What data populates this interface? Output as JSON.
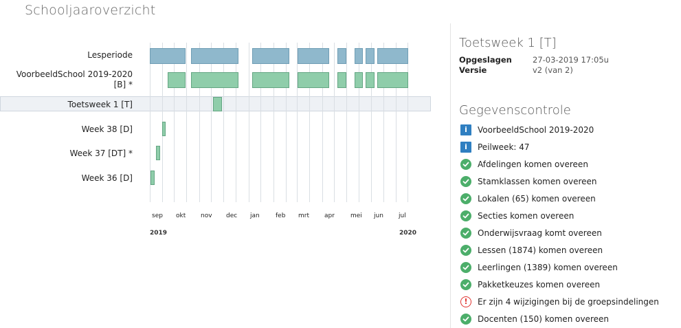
{
  "page_title": "Schooljaaroverzicht",
  "timeline": {
    "rows": [
      {
        "label": "Lesperiode",
        "segments": [
          [
            "2019-09-01",
            "2019-10-15"
          ],
          [
            "2019-10-22",
            "2019-12-20"
          ],
          [
            "2020-01-06",
            "2020-02-21"
          ],
          [
            "2020-03-02",
            "2020-04-10"
          ],
          [
            "2020-04-20",
            "2020-05-01"
          ],
          [
            "2020-05-11",
            "2020-05-22"
          ],
          [
            "2020-05-25",
            "2020-06-05"
          ],
          [
            "2020-06-08",
            "2020-07-17"
          ]
        ]
      },
      {
        "label": "VoorbeeldSchool 2019-2020\n[B] *",
        "segments": [
          [
            "2019-09-23",
            "2019-10-15"
          ],
          [
            "2019-10-22",
            "2019-12-20"
          ],
          [
            "2020-01-06",
            "2020-02-21"
          ],
          [
            "2020-03-02",
            "2020-04-10"
          ],
          [
            "2020-04-20",
            "2020-05-01"
          ],
          [
            "2020-05-11",
            "2020-05-22"
          ],
          [
            "2020-05-25",
            "2020-06-05"
          ],
          [
            "2020-06-08",
            "2020-07-17"
          ]
        ]
      },
      {
        "label": "Toetsweek 1 [T]",
        "segments": [
          [
            "2019-11-18",
            "2019-11-29"
          ]
        ],
        "selected": true
      },
      {
        "label": "Week 38 [D]",
        "segments": [
          [
            "2019-09-16",
            "2019-09-21"
          ]
        ]
      },
      {
        "label": "Week 37 [DT] *",
        "segments": [
          [
            "2019-09-09",
            "2019-09-14"
          ]
        ]
      },
      {
        "label": "Week 36 [D]",
        "segments": [
          [
            "2019-09-02",
            "2019-09-07"
          ]
        ]
      }
    ],
    "months": [
      "sep",
      "okt",
      "nov",
      "dec",
      "jan",
      "feb",
      "mrt",
      "apr",
      "mei",
      "jun",
      "jul"
    ],
    "years": {
      "start": "2019",
      "end": "2020"
    },
    "colors": {
      "lesperiode": "#8fb8cc",
      "period": "#8fcdaa",
      "selected_band": "#eef1f5"
    }
  },
  "details": {
    "title": "Toetsweek 1 [T]",
    "saved_label": "Opgeslagen",
    "saved_value": "27-03-2019 17:05u",
    "version_label": "Versie",
    "version_value": "v2 (van 2)"
  },
  "checks": {
    "title": "Gegevenscontrole",
    "items": [
      {
        "icon": "info-icon",
        "text": "VoorbeeldSchool 2019-2020"
      },
      {
        "icon": "info-icon",
        "text": "Peilweek: 47"
      },
      {
        "icon": "check-icon",
        "text": "Afdelingen komen overeen"
      },
      {
        "icon": "check-icon",
        "text": "Stamklassen komen overeen"
      },
      {
        "icon": "check-icon",
        "text": "Lokalen (65) komen overeen"
      },
      {
        "icon": "check-icon",
        "text": "Secties komen overeen"
      },
      {
        "icon": "check-icon",
        "text": "Onderwijsvraag komt overeen"
      },
      {
        "icon": "check-icon",
        "text": "Lessen (1874) komen overeen"
      },
      {
        "icon": "check-icon",
        "text": "Leerlingen (1389) komen overeen"
      },
      {
        "icon": "check-icon",
        "text": "Pakketkeuzes komen overeen"
      },
      {
        "icon": "warning-icon",
        "text": "Er zijn 4 wijzigingen bij de groepsindelingen"
      },
      {
        "icon": "check-icon",
        "text": "Docenten (150) komen overeen"
      }
    ],
    "colors": {
      "info": "#2f7fc1",
      "check": "#4cae6a",
      "warning": "#e0322f"
    }
  }
}
